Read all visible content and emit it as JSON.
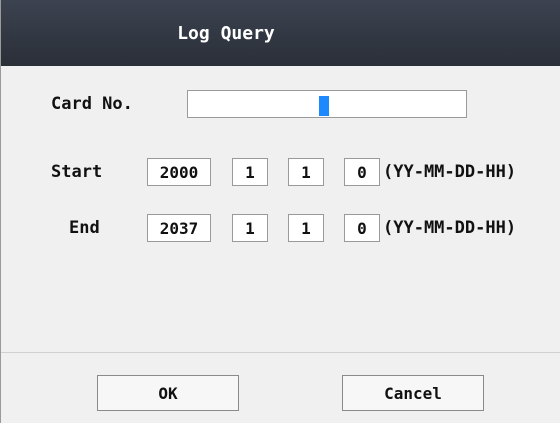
{
  "dialog": {
    "title": "Log Query"
  },
  "card": {
    "label": "Card No.",
    "value": ""
  },
  "start": {
    "label": "Start",
    "year": "2000",
    "month": "1",
    "day": "1",
    "hour": "0",
    "format_hint": "(YY-MM-DD-HH)"
  },
  "end": {
    "label": "End",
    "year": "2037",
    "month": "1",
    "day": "1",
    "hour": "0",
    "format_hint": "(YY-MM-DD-HH)"
  },
  "buttons": {
    "ok": "OK",
    "cancel": "Cancel"
  },
  "colors": {
    "title_bar": "#2f3540",
    "cursor": "#1e88ff"
  }
}
